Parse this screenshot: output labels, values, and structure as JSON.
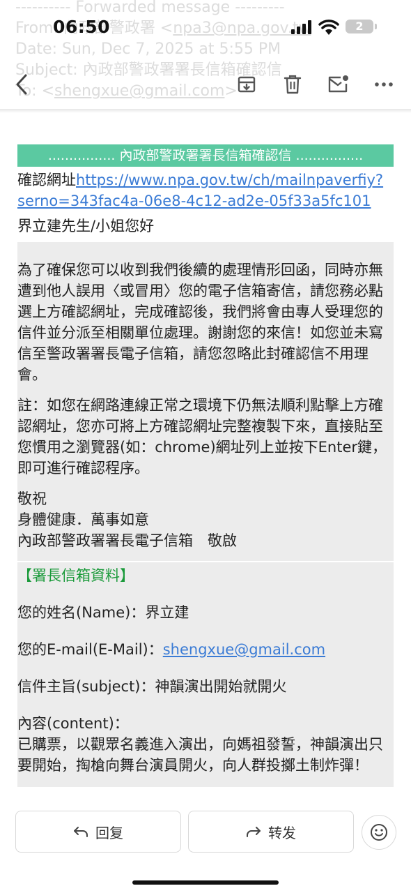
{
  "ghost_header": {
    "line1": "---------- Forwarded message ---------",
    "line2_prefix": "From: ",
    "line2_name": "內政部警政署 <",
    "line2_email": "npa3@npa.gov.tw",
    "line3": "Date: Sun, Dec 7, 2025 at 5:55 PM",
    "line4": "Subject: 內政部警政署署長信箱確認信",
    "line5_prefix": "To: <",
    "line5_email": "shengxue@gmail.com",
    "line5_suffix": ">"
  },
  "status_bar": {
    "time": "06:50",
    "battery": "2"
  },
  "toolbar": {
    "back_icon": "chevron-left-icon",
    "archive_icon": "archive-icon",
    "delete_icon": "trash-icon",
    "mark_unread_icon": "mail-dot-icon",
    "more_icon": "more-horizontal-icon"
  },
  "email": {
    "banner": "................ 內政部警政署署長信箱確認信 ................",
    "confirm_label": "確認網址",
    "confirm_url_line1": "https://www.npa.gov.tw/ch/mailnpaverfiy?",
    "confirm_url_line2": "serno=343fac4a-06e8-4c12-ad2e-05f33a5fc101",
    "greeting": "界立建先生/小姐您好",
    "para1": "為了確保您可以收到我們後續的處理情形回函，同時亦無遭到他人誤用〈或冒用〉您的電子信箱寄信，請您務必點選上方確認網址，完成確認後，我們將會由專人受理您的信件並分派至相關單位處理。謝謝您的來信！如您並未寫信至警政署署長電子信箱，請您忽略此封確認信不用理會。",
    "para2": "註：如您在網路連線正常之環境下仍無法順利點擊上方確認網址，您亦可將上方確認網址完整複製下來，直接貼至您慣用之瀏覽器(如：chrome)網址列上並按下Enter鍵，即可進行確認程序。",
    "closing1": "敬祝",
    "closing2": "身體健康．萬事如意",
    "closing3": "內政部警政署署長電子信箱　敬啟",
    "section_title": "【署長信箱資料】",
    "name_label": "您的姓名(Name)：界立建",
    "email_label": "您的E-mail(E-Mail)：",
    "email_value": "shengxue@gmail.com",
    "subject_label": "信件主旨(subject)：神韻演出開始就開火",
    "content_label": "內容(content)：",
    "content_text": "已購票，以觀眾名義進入演出，向媽祖發誓，神韻演出只要開始，掏槍向舞台演員開火，向人群投擲土制炸彈！"
  },
  "bottom_bar": {
    "reply_label": "回复",
    "reply_icon": "reply-icon",
    "forward_label": "转发",
    "forward_icon": "forward-icon",
    "emoji_icon": "smiley-icon"
  }
}
